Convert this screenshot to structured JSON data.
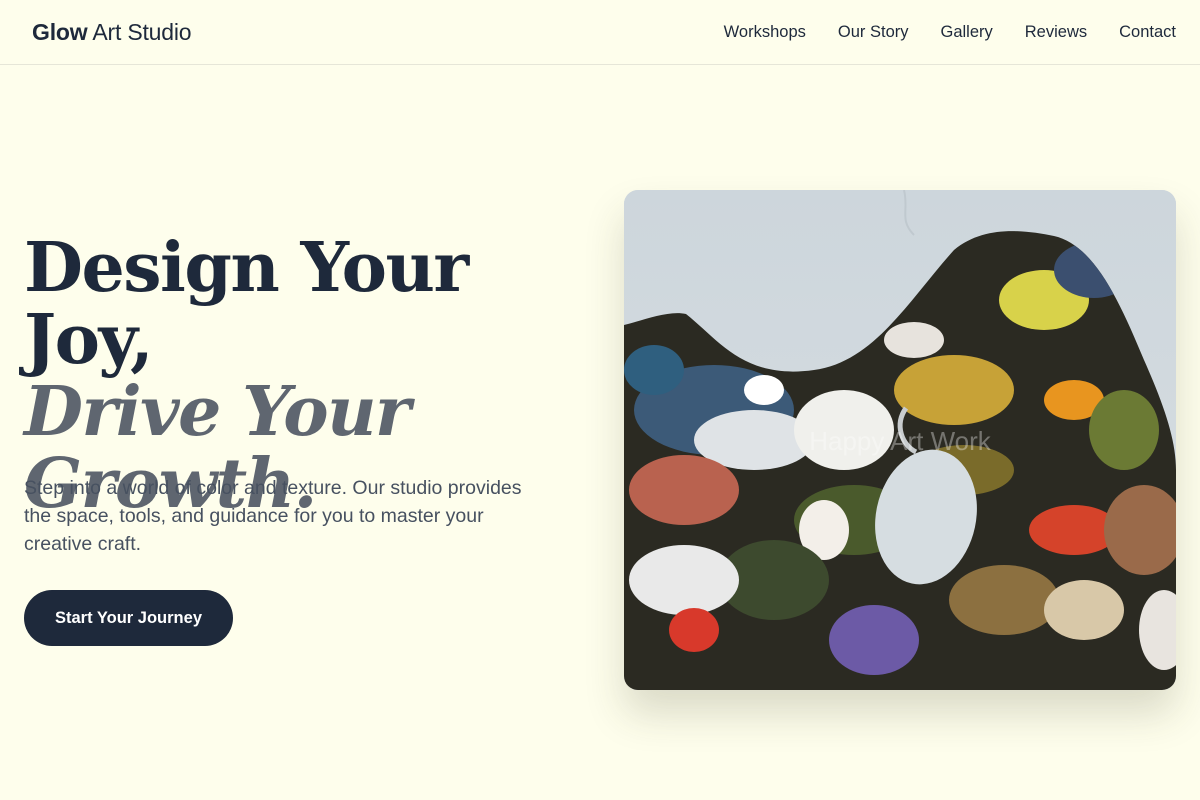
{
  "brand": {
    "name_bold": "Glow",
    "name_rest": "Art Studio"
  },
  "nav": {
    "items": [
      {
        "label": "Workshops"
      },
      {
        "label": "Our Story"
      },
      {
        "label": "Gallery"
      },
      {
        "label": "Reviews"
      },
      {
        "label": "Contact"
      }
    ]
  },
  "hero": {
    "title_line1": "Design Your Joy,",
    "title_line2a": "Drive Your",
    "title_line2b": "Growth.",
    "subtitle": "Step into a world of color and texture. Our studio provides the space, tools, and guidance for you to master your creative craft.",
    "cta_label": "Start Your Journey",
    "image_watermark": "Happy Art Work"
  },
  "colors": {
    "page_background": "#fefeec",
    "primary_dark": "#1e293b",
    "accent_gray": "#5f6670",
    "body_text": "#475160"
  }
}
